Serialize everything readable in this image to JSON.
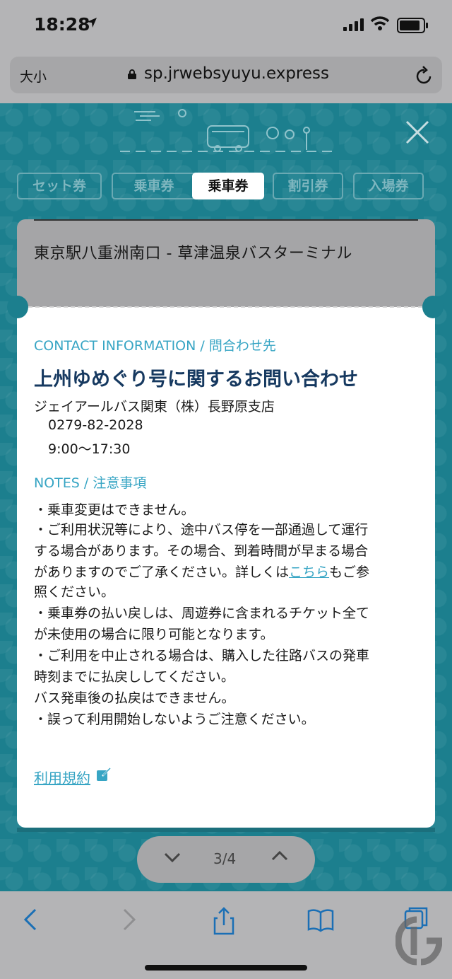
{
  "status_bar": {
    "time": "18:28",
    "icons": [
      "location-arrow-icon",
      "signal-icon",
      "wifi-icon",
      "battery-icon"
    ]
  },
  "browser": {
    "text_size_label": "大小",
    "url": "sp.jrwebsyuyu.express"
  },
  "tabs": [
    {
      "label": "セット券",
      "active": false
    },
    {
      "label": "乗車券",
      "active": false
    },
    {
      "label": "乗車券",
      "active": true
    },
    {
      "label": "割引券",
      "active": false
    },
    {
      "label": "入場券",
      "active": false
    }
  ],
  "route": "東京駅八重洲南口 - 草津温泉バスターミナル",
  "contact": {
    "heading": "CONTACT INFORMATION / 問合わせ先",
    "title": "上州ゆめぐり号に関するお問い合わせ",
    "company": "ジェイアールバス関東（株）長野原支店",
    "phone": "0279-82-2028",
    "hours": "9:00〜17:30"
  },
  "notes": {
    "heading": "NOTES / 注意事項",
    "lines": [
      "・乗車変更はできません。",
      "・ご利用状況等により、途中バス停を一部通過して運行",
      "する場合があります。その場合、到着時間が早まる場合",
      "がありますのでご了承ください。詳しくは",
      "照ください。",
      "・乗車券の払い戻しは、周遊券に含まれるチケット全て",
      "が未使用の場合に限り可能となります。",
      "・ご利用を中止される場合は、購入した往路バスの発車",
      "時刻までに払戻ししてください。",
      "バス発車後の払戻はできません。",
      "・誤って利用開始しないようご注意ください。"
    ],
    "link_text": "こちら",
    "link_suffix": "もご参"
  },
  "terms_link": "利用規約",
  "pager": {
    "label": "3/4"
  },
  "colors": {
    "teal_bg": "#1c7f8e",
    "link": "#37a5c4",
    "title": "#163960"
  }
}
